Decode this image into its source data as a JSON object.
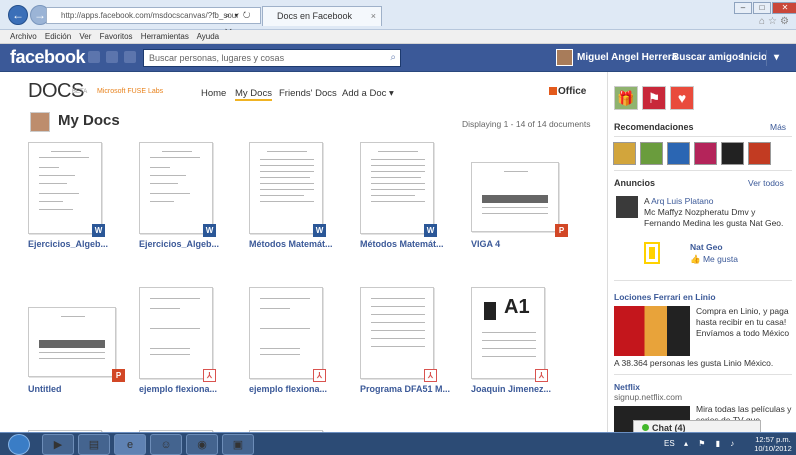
{
  "browser": {
    "address": "http://apps.facebook.com/msdocscanvas/?fb_sour",
    "address_domain": "facebook.com",
    "tab_title": "Docs en Facebook",
    "menu": [
      "Archivo",
      "Edición",
      "Ver",
      "Favoritos",
      "Herramientas",
      "Ayuda"
    ]
  },
  "facebook": {
    "logo": "facebook",
    "search_placeholder": "Buscar personas, lugares y cosas",
    "user_name": "Miguel Angel Herrera",
    "find_friends": "Buscar amigos",
    "home": "Inicio",
    "menu_arrow": "▾"
  },
  "docs_app": {
    "logo": "DOCS",
    "beta": "BETA",
    "lab": "Microsoft FUSE Labs",
    "nav": [
      "Home",
      "My Docs",
      "Friends' Docs",
      "Add a Doc ▾"
    ],
    "office_logo": "Office",
    "page_title": "My Docs",
    "displaying": "Displaying 1 - 14 of 14 documents",
    "documents": [
      {
        "title": "Ejercicios_Algeb...",
        "type": "word"
      },
      {
        "title": "Ejercicios_Algeb...",
        "type": "word"
      },
      {
        "title": "Métodos Matemát...",
        "type": "word"
      },
      {
        "title": "Métodos Matemát...",
        "type": "word"
      },
      {
        "title": "VIGA 4",
        "type": "ppt"
      },
      {
        "title": "Untitled",
        "type": "ppt"
      },
      {
        "title": "ejemplo flexiona...",
        "type": "pdf"
      },
      {
        "title": "ejemplo flexiona...",
        "type": "pdf"
      },
      {
        "title": "Programa DFA51 M...",
        "type": "pdf"
      },
      {
        "title": "Joaquin Jimenez...",
        "type": "pdf",
        "thumb_text": "A1"
      }
    ]
  },
  "sidebar": {
    "recommendations": "Recomendaciones",
    "more": "Más",
    "ads": "Anuncios",
    "see_all": "Ver todos",
    "social_ad_name": "Arq Luis Platano",
    "social_ad_text": "Mc Maffyz Nozpheratu Dmv y Fernando Medina les gusta Nat Geo.",
    "social_ad_prefix": "A",
    "natgeo_title": "Nat Geo",
    "natgeo_like": "Me gusta",
    "lociones_title": "Lociones Ferrari en Linio",
    "lociones_text": "Compra en Linio, y paga hasta recibir en tu casa! Envíamos a todo México",
    "lociones_likes": "A 38.364 personas les gusta Linio México.",
    "netflix_title": "Netflix",
    "netflix_url": "signup.netflix.com",
    "netflix_text": "Mira todas las películas y series de TV que"
  },
  "chat": {
    "label": "Chat (4)"
  },
  "taskbar": {
    "lang": "ES",
    "time": "12:57 p.m.",
    "date": "10/10/2012"
  },
  "colors": {
    "facebook_blue": "#3b5998",
    "nav_active": "#f0b323",
    "word": "#2b5797",
    "pdf": "#d9534f",
    "ppt": "#d24726"
  }
}
